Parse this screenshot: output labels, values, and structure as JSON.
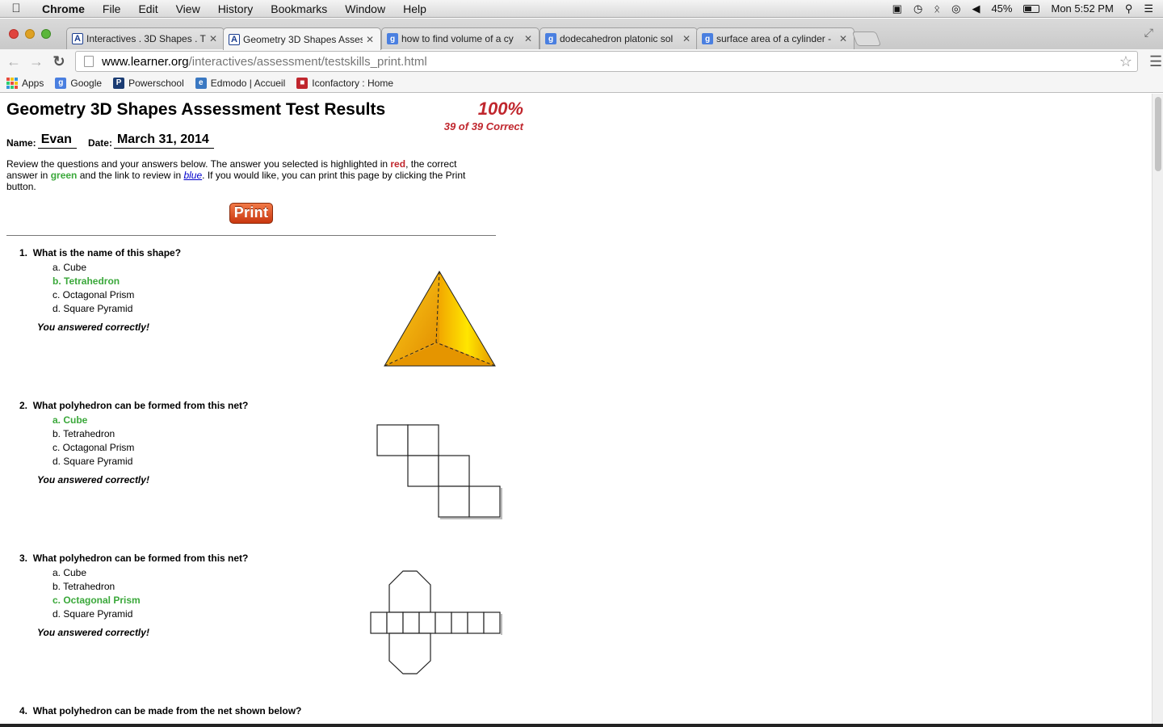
{
  "menubar": {
    "app": "Chrome",
    "items": [
      "File",
      "Edit",
      "View",
      "History",
      "Bookmarks",
      "Window",
      "Help"
    ],
    "battery": "45%",
    "clock": "Mon 5:52 PM"
  },
  "tabs": [
    {
      "title": "Interactives . 3D Shapes . T",
      "icon": "learner"
    },
    {
      "title": "Geometry 3D Shapes Asses",
      "icon": "learner"
    },
    {
      "title": "how to find volume of a cy",
      "icon": "google"
    },
    {
      "title": "dodecahedron platonic sol",
      "icon": "google"
    },
    {
      "title": "surface area of a cylinder -",
      "icon": "google"
    }
  ],
  "address": {
    "host": "www.learner.org",
    "path": "/interactives/assessment/testskills_print.html"
  },
  "bookmarks": [
    "Apps",
    "Google",
    "Powerschool",
    "Edmodo | Accueil",
    "Iconfactory : Home"
  ],
  "page": {
    "title": "Geometry 3D Shapes Assessment Test Results",
    "score_percent": "100%",
    "score_count": "39 of 39 Correct",
    "name_label": "Name:",
    "name_value": "Evan",
    "date_label": "Date:",
    "date_value": "March 31, 2014",
    "intro": {
      "p1": "Review the questions and your answers below. The answer you selected is highlighted in ",
      "red": "red",
      "p2": ", the correct answer in ",
      "green": "green",
      "p3": " and the link to review in ",
      "blue": "blue",
      "p4": ". If you would like, you can print this page by clicking the Print button."
    },
    "print_label": "Print",
    "questions": [
      {
        "number": "1.",
        "text": "What is the name of this shape?",
        "choices": [
          "a. Cube",
          "b. Tetrahedron",
          "c. Octagonal Prism",
          "d. Square Pyramid"
        ],
        "correct_index": 1,
        "feedback": "You answered correctly!"
      },
      {
        "number": "2.",
        "text": "What polyhedron can be formed from this net?",
        "choices": [
          "a. Cube",
          "b. Tetrahedron",
          "c. Octagonal Prism",
          "d. Square Pyramid"
        ],
        "correct_index": 0,
        "feedback": "You answered correctly!"
      },
      {
        "number": "3.",
        "text": "What polyhedron can be formed from this net?",
        "choices": [
          "a. Cube",
          "b. Tetrahedron",
          "c. Octagonal Prism",
          "d. Square Pyramid"
        ],
        "correct_index": 2,
        "feedback": "You answered correctly!"
      },
      {
        "number": "4.",
        "text": "What polyhedron can be made from the net shown below?"
      }
    ]
  },
  "colors": {
    "correct": "#3aa83a",
    "selected": "#c0262d",
    "review_link": "#0000cc",
    "print_button": "#d8481a",
    "shape_fill": "#f2b10f"
  }
}
